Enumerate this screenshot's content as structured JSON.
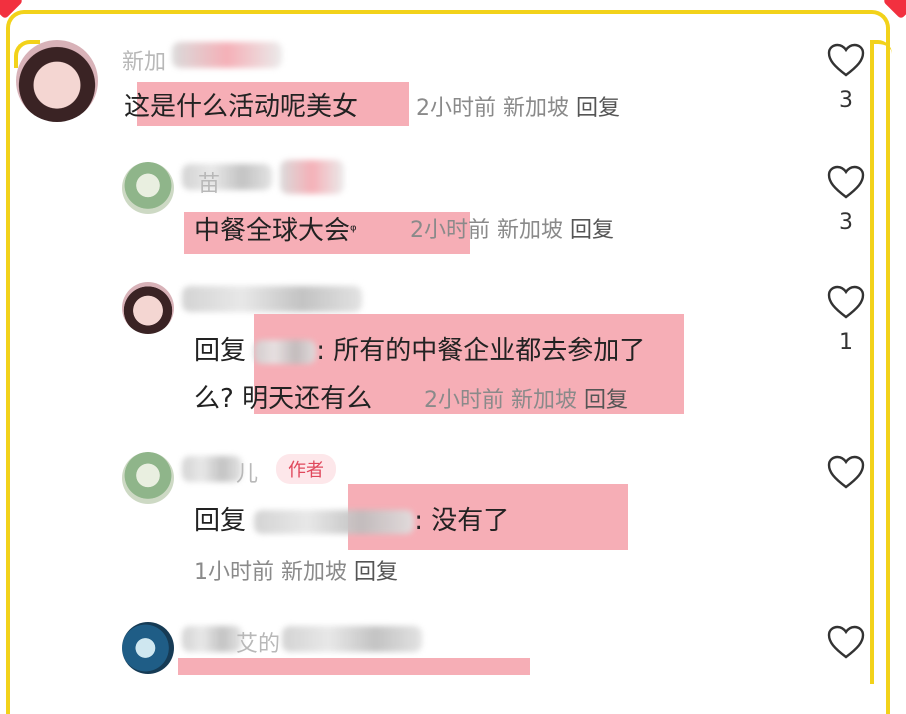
{
  "comments": [
    {
      "name_partial": "新加",
      "text": "这是什么活动呢美女",
      "time": "2小时前",
      "location": "新加坡",
      "reply_label": "回复",
      "likes": "3"
    },
    {
      "name_partial": "苗",
      "text": "中餐全球大会",
      "text_icon": "ᵠ",
      "time": "2小时前",
      "location": "新加坡",
      "reply_label": "回复",
      "likes": "3"
    },
    {
      "text_line1_prefix": "回复",
      "text_line1_body": ": 所有的中餐企业都去参加了",
      "text_line2_body": "么? 明天还有么",
      "time": "2小时前",
      "location": "新加坡",
      "reply_label": "回复",
      "likes": "1"
    },
    {
      "name_partial": "儿",
      "badge": "作者",
      "text_prefix": "回复",
      "text_body": ": 没有了",
      "time": "1小时前",
      "location": "新加坡",
      "reply_label": "回复",
      "likes": ""
    },
    {
      "name_partial": "艾的",
      "likes": ""
    }
  ],
  "colors": {
    "frame": "#f2d21a",
    "highlight": "#f5a5ae",
    "badge_text": "#e0485c",
    "badge_bg": "#fde7ea",
    "corner_heart": "#f2303f"
  },
  "icons": [
    "heart-outline-icon"
  ]
}
